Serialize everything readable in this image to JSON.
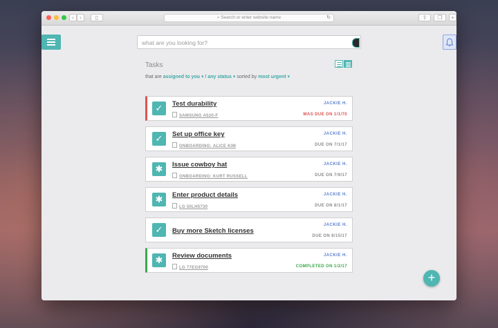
{
  "browser": {
    "url_placeholder": "Search or enter website name"
  },
  "app": {
    "search": {
      "placeholder": "what are you looking for?"
    },
    "section_title": "Tasks",
    "filter": {
      "prefix": "that are",
      "assignment": "assigned to you",
      "separator": "/",
      "status": "any status",
      "sorted_label": "sorted by",
      "sort": "most urgent"
    },
    "tasks": [
      {
        "title": "Test durability",
        "subtitle": "SAMSUNG A520-F",
        "assignee": "JACKIE H.",
        "due": "WAS DUE ON 1/1/70",
        "status": "overdue",
        "icon": "check-icon"
      },
      {
        "title": "Set up office key",
        "subtitle": "ONBOARDING: ALICE KIM",
        "assignee": "JACKIE H.",
        "due": "DUE ON 7/1/17",
        "status": "pending",
        "icon": "check-icon"
      },
      {
        "title": "Issue cowboy hat",
        "subtitle": "ONBOARDING: KURT RUSSELL",
        "assignee": "JACKIE H.",
        "due": "DUE ON 7/9/17",
        "status": "pending",
        "icon": "asterisk-icon"
      },
      {
        "title": "Enter product details",
        "subtitle": "LG 50LH5730",
        "assignee": "JACKIE H.",
        "due": "DUE ON 8/1/17",
        "status": "pending",
        "icon": "asterisk-icon"
      },
      {
        "title": "Buy more Sketch licenses",
        "subtitle": "",
        "assignee": "JACKIE H.",
        "due": "DUE ON 8/15/17",
        "status": "pending",
        "icon": "check-icon"
      },
      {
        "title": "Review documents",
        "subtitle": "LG 77EG9700",
        "assignee": "JACKIE H.",
        "due": "COMPLETED ON 1/2/17",
        "status": "completed",
        "icon": "asterisk-icon"
      }
    ],
    "fab_label": "+"
  },
  "colors": {
    "accent": "#4fb6b2",
    "overdue": "#d9534f",
    "completed": "#3aa64b",
    "assignee": "#5b7fd1"
  }
}
